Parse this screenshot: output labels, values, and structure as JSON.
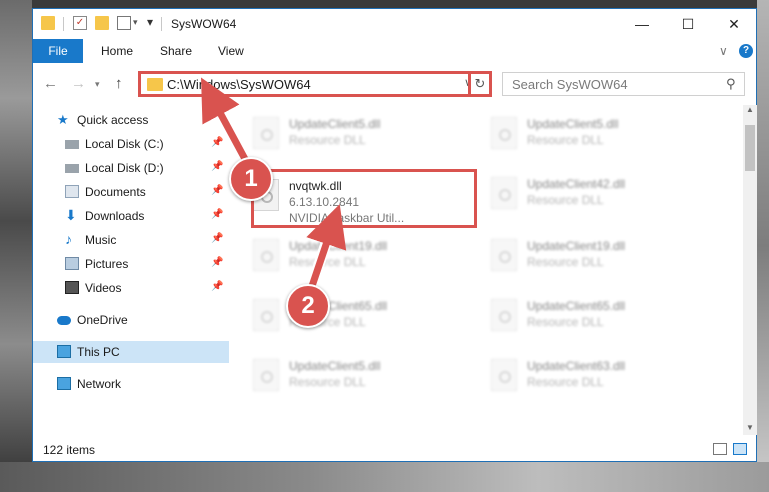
{
  "window": {
    "title": "SysWOW64"
  },
  "ribbon": {
    "file": "File",
    "home": "Home",
    "share": "Share",
    "view": "View"
  },
  "address": {
    "path": "C:\\Windows\\SysWOW64"
  },
  "search": {
    "placeholder": "Search SysWOW64"
  },
  "sidebar": {
    "items": [
      {
        "label": "Quick access"
      },
      {
        "label": "Local Disk (C:)"
      },
      {
        "label": "Local Disk (D:)"
      },
      {
        "label": "Documents"
      },
      {
        "label": "Downloads"
      },
      {
        "label": "Music"
      },
      {
        "label": "Pictures"
      },
      {
        "label": "Videos"
      },
      {
        "label": "OneDrive"
      },
      {
        "label": "This PC"
      },
      {
        "label": "Network"
      }
    ]
  },
  "files": {
    "left": [
      {
        "name": "UpdateClient5.dll",
        "desc": "Resource DLL"
      },
      {
        "name": "nvqtwk.dll",
        "desc": "6.13.10.2841",
        "desc2": "NVIDIA Taskbar Util..."
      },
      {
        "name": "UpdateClient19.dll",
        "desc": "Resource DLL"
      },
      {
        "name": "UpdateClient65.dll",
        "desc": "Resource DLL"
      },
      {
        "name": "UpdateClient5.dll",
        "desc": "Resource DLL"
      }
    ],
    "right": [
      {
        "name": "UpdateClient5.dll",
        "desc": "Resource DLL"
      },
      {
        "name": "UpdateClient42.dll",
        "desc": "Resource DLL"
      },
      {
        "name": "UpdateClient19.dll",
        "desc": "Resource DLL"
      },
      {
        "name": "UpdateClient65.dll",
        "desc": "Resource DLL"
      },
      {
        "name": "UpdateClient63.dll",
        "desc": "Resource DLL"
      }
    ]
  },
  "status": {
    "count": "122 items"
  },
  "annotations": {
    "badge1": "1",
    "badge2": "2"
  },
  "colors": {
    "accent": "#1979ca",
    "highlight": "#d9534f",
    "selected": "#cce4f7"
  }
}
